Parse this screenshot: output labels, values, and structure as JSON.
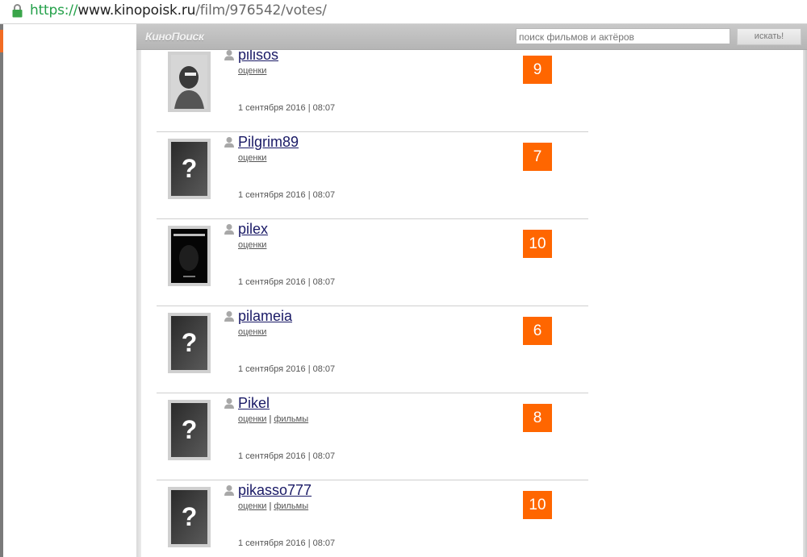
{
  "browser": {
    "url_scheme": "https://",
    "url_host": "www.kinopoisk.ru",
    "url_path": "/film/976542/votes/"
  },
  "header": {
    "logo": "КиноПоиск",
    "search_placeholder": "поиск фильмов и актёров",
    "search_button": "искать!"
  },
  "colors": {
    "accent": "#ff6600",
    "username": "#1a1a66",
    "scheme": "#23a049"
  },
  "votes": [
    {
      "username": "pilisos",
      "avatar": "photo",
      "links": [
        "оценки"
      ],
      "date": "1 сентября 2016 | 08:07",
      "rating": "9"
    },
    {
      "username": "Pilgrim89",
      "avatar": "question",
      "links": [
        "оценки"
      ],
      "date": "1 сентября 2016 | 08:07",
      "rating": "7"
    },
    {
      "username": "pilex",
      "avatar": "poster",
      "links": [
        "оценки"
      ],
      "date": "1 сентября 2016 | 08:07",
      "rating": "10"
    },
    {
      "username": "pilameia",
      "avatar": "question",
      "links": [
        "оценки"
      ],
      "date": "1 сентября 2016 | 08:07",
      "rating": "6"
    },
    {
      "username": "Pikel",
      "avatar": "question",
      "links": [
        "оценки",
        "фильмы"
      ],
      "date": "1 сентября 2016 | 08:07",
      "rating": "8"
    },
    {
      "username": "pikasso777",
      "avatar": "question",
      "links": [
        "оценки",
        "фильмы"
      ],
      "date": "1 сентября 2016 | 08:07",
      "rating": "10"
    }
  ]
}
